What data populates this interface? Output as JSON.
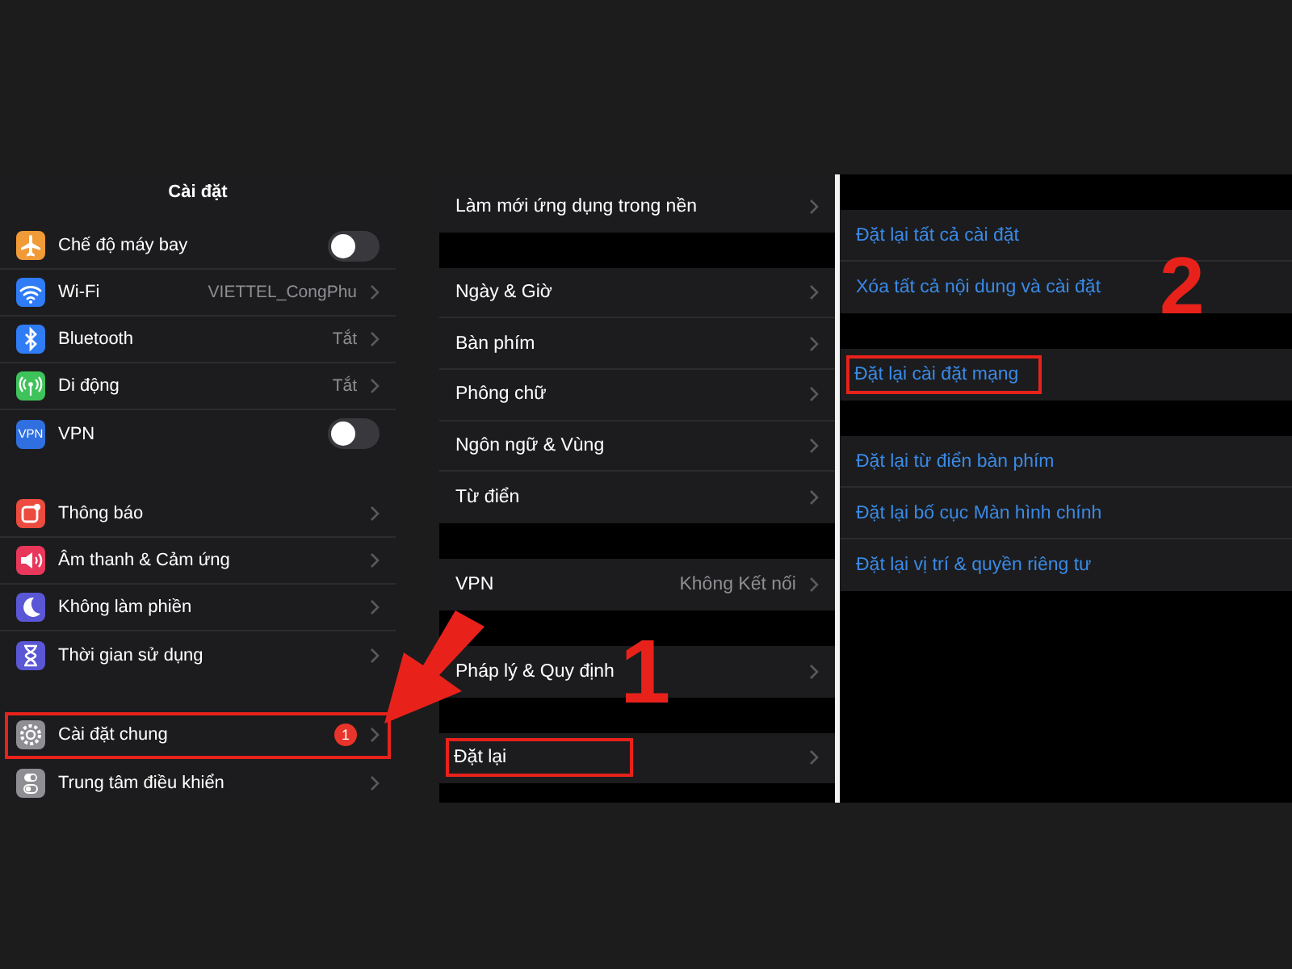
{
  "columns": [
    {
      "title": "Cài đặt",
      "groups": [
        {
          "items": [
            {
              "label": "Chế độ máy bay",
              "kind": "toggle",
              "on": false,
              "color": "#f19a38"
            },
            {
              "label": "Wi-Fi",
              "kind": "value",
              "value": "VIETTEL_CongPhu",
              "color": "#2f7cf6"
            },
            {
              "label": "Bluetooth",
              "kind": "value",
              "value": "Tắt",
              "color": "#2f7cf6"
            },
            {
              "label": "Di động",
              "kind": "value",
              "value": "Tắt",
              "color": "#3ec35a"
            },
            {
              "label": "VPN",
              "kind": "toggle",
              "on": false,
              "color": "#2f6fe0",
              "icon_text": "VPN"
            }
          ]
        },
        {
          "items": [
            {
              "label": "Thông báo",
              "kind": "link",
              "color": "#ec4b3f"
            },
            {
              "label": "Âm thanh & Cảm ứng",
              "kind": "link",
              "color": "#e8375a"
            },
            {
              "label": "Không làm phiền",
              "kind": "link",
              "color": "#5a57d6"
            },
            {
              "label": "Thời gian sử dụng",
              "kind": "link",
              "color": "#5a57d6"
            }
          ]
        },
        {
          "items": [
            {
              "label": "Cài đặt chung",
              "kind": "link",
              "color": "#8e8e93",
              "badge": "1",
              "highlighted": true
            },
            {
              "label": "Trung tâm điều khiển",
              "kind": "link",
              "color": "#8e8e93"
            }
          ]
        }
      ]
    },
    {
      "groups": [
        {
          "items": [
            {
              "label": "Làm mới ứng dụng trong nền",
              "kind": "link"
            }
          ]
        },
        {
          "items": [
            {
              "label": "Ngày & Giờ",
              "kind": "link"
            },
            {
              "label": "Bàn phím",
              "kind": "link"
            },
            {
              "label": "Phông chữ",
              "kind": "link"
            },
            {
              "label": "Ngôn ngữ & Vùng",
              "kind": "link"
            },
            {
              "label": "Từ điển",
              "kind": "link"
            }
          ]
        },
        {
          "items": [
            {
              "label": "VPN",
              "kind": "value",
              "value": "Không Kết nối"
            }
          ]
        },
        {
          "items": [
            {
              "label": "Pháp lý & Quy định",
              "kind": "link"
            }
          ]
        },
        {
          "items": [
            {
              "label": "Đặt lại",
              "kind": "link",
              "highlighted": true
            }
          ]
        }
      ]
    },
    {
      "groups": [
        {
          "items": [
            {
              "label": "Đặt lại tất cả cài đặt",
              "kind": "action"
            },
            {
              "label": "Xóa tất cả nội dung và cài đặt",
              "kind": "action"
            }
          ]
        },
        {
          "items": [
            {
              "label": "Đặt lại cài đặt mạng",
              "kind": "action",
              "highlighted": true
            }
          ]
        },
        {
          "items": [
            {
              "label": "Đặt lại từ điển bàn phím",
              "kind": "action"
            },
            {
              "label": "Đặt lại bố cục Màn hình chính",
              "kind": "action"
            },
            {
              "label": "Đặt lại vị trí & quyền riêng tư",
              "kind": "action"
            }
          ]
        }
      ]
    }
  ],
  "annotations": [
    {
      "kind": "arrow"
    },
    {
      "kind": "step",
      "text": "1"
    },
    {
      "kind": "step",
      "text": "2"
    }
  ]
}
